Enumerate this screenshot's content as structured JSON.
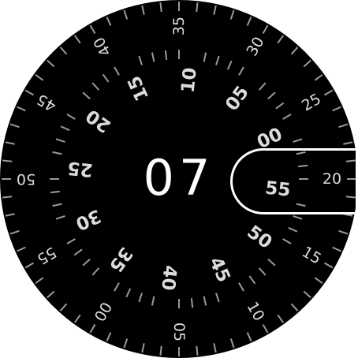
{
  "watch_face": {
    "hour": "07",
    "seconds_ring": {
      "labels": [
        "20",
        "25",
        "30",
        "35",
        "40",
        "45",
        "50",
        "55",
        "00",
        "05",
        "10",
        "15"
      ],
      "label_color": "#dcdcdc"
    },
    "minutes_ring": {
      "labels": [
        "55",
        "00",
        "05",
        "10",
        "15",
        "20",
        "25",
        "30",
        "35",
        "40",
        "45",
        "50"
      ],
      "selected": "55"
    },
    "background": "#000000",
    "tick_color": "#9a9a9a"
  }
}
